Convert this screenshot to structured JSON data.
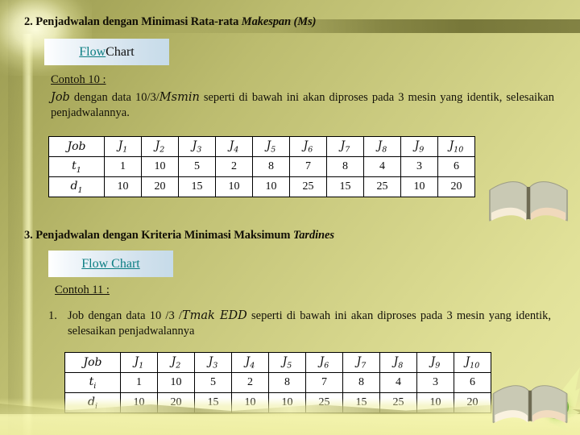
{
  "slide": {
    "sections": [
      {
        "heading_prefix": "2. Penjadwalan dengan Minimasi Rata-rata ",
        "heading_italic": "Makespan (Ms)",
        "flow_chart": {
          "link_text": "Flow",
          "plain_text": " Chart"
        },
        "example_label": "Contoh 10 :",
        "body_lead_italic": "Job",
        "body_text": " dengan data 10/3/",
        "body_italic2": "Msmin",
        "body_text2": " seperti di bawah ini akan diproses pada 3 mesin yang identik, selesaikan penjadwalannya."
      },
      {
        "heading_prefix": "3. Penjadwalan dengan Kriteria Minimasi Maksimum ",
        "heading_italic": "Tardines",
        "flow_chart": {
          "link_text": "Flow Chart",
          "plain_text": ""
        },
        "example_label": "Contoh 11 :",
        "list_number": "1.",
        "body_text": "Job dengan data 10 /3 /",
        "body_italic2": "Tmak EDD",
        "body_text2": " seperti di bawah ini akan diproses pada 3 mesin yang identik, selesaikan penjadwalannya"
      }
    ],
    "tables": [
      {
        "row_labels": [
          "Job",
          "t",
          "d"
        ],
        "row_label_subs": [
          "",
          "1",
          "1"
        ],
        "job_headers": [
          "J",
          "J",
          "J",
          "J",
          "J",
          "J",
          "J",
          "J",
          "J",
          "J"
        ],
        "job_header_subs": [
          "1",
          "2",
          "3",
          "4",
          "5",
          "6",
          "7",
          "8",
          "9",
          "10"
        ],
        "t_values": [
          "1",
          "10",
          "5",
          "2",
          "8",
          "7",
          "8",
          "4",
          "3",
          "6"
        ],
        "d_values": [
          "10",
          "20",
          "15",
          "10",
          "10",
          "25",
          "15",
          "25",
          "10",
          "20"
        ]
      },
      {
        "row_labels": [
          "Job",
          "t",
          "d"
        ],
        "row_label_subs": [
          "",
          "i",
          "i"
        ],
        "job_headers": [
          "J",
          "J",
          "J",
          "J",
          "J",
          "J",
          "J",
          "J",
          "J",
          "J"
        ],
        "job_header_subs": [
          "1",
          "2",
          "3",
          "4",
          "5",
          "6",
          "7",
          "8",
          "9",
          "10"
        ],
        "t_values": [
          "1",
          "10",
          "5",
          "2",
          "8",
          "7",
          "8",
          "4",
          "3",
          "6"
        ],
        "d_values": [
          "10",
          "20",
          "15",
          "10",
          "10",
          "25",
          "15",
          "25",
          "10",
          "20"
        ]
      }
    ],
    "decorations": {
      "book_top": "open-book-image",
      "book_bottom": "open-book-image",
      "sphere": "glowing-green-sphere"
    },
    "colors": {
      "link": "#0a7d82",
      "text": "#141208",
      "bg_top_left": "#9a9a52",
      "bg_bottom_right": "#e8e8a4"
    }
  }
}
